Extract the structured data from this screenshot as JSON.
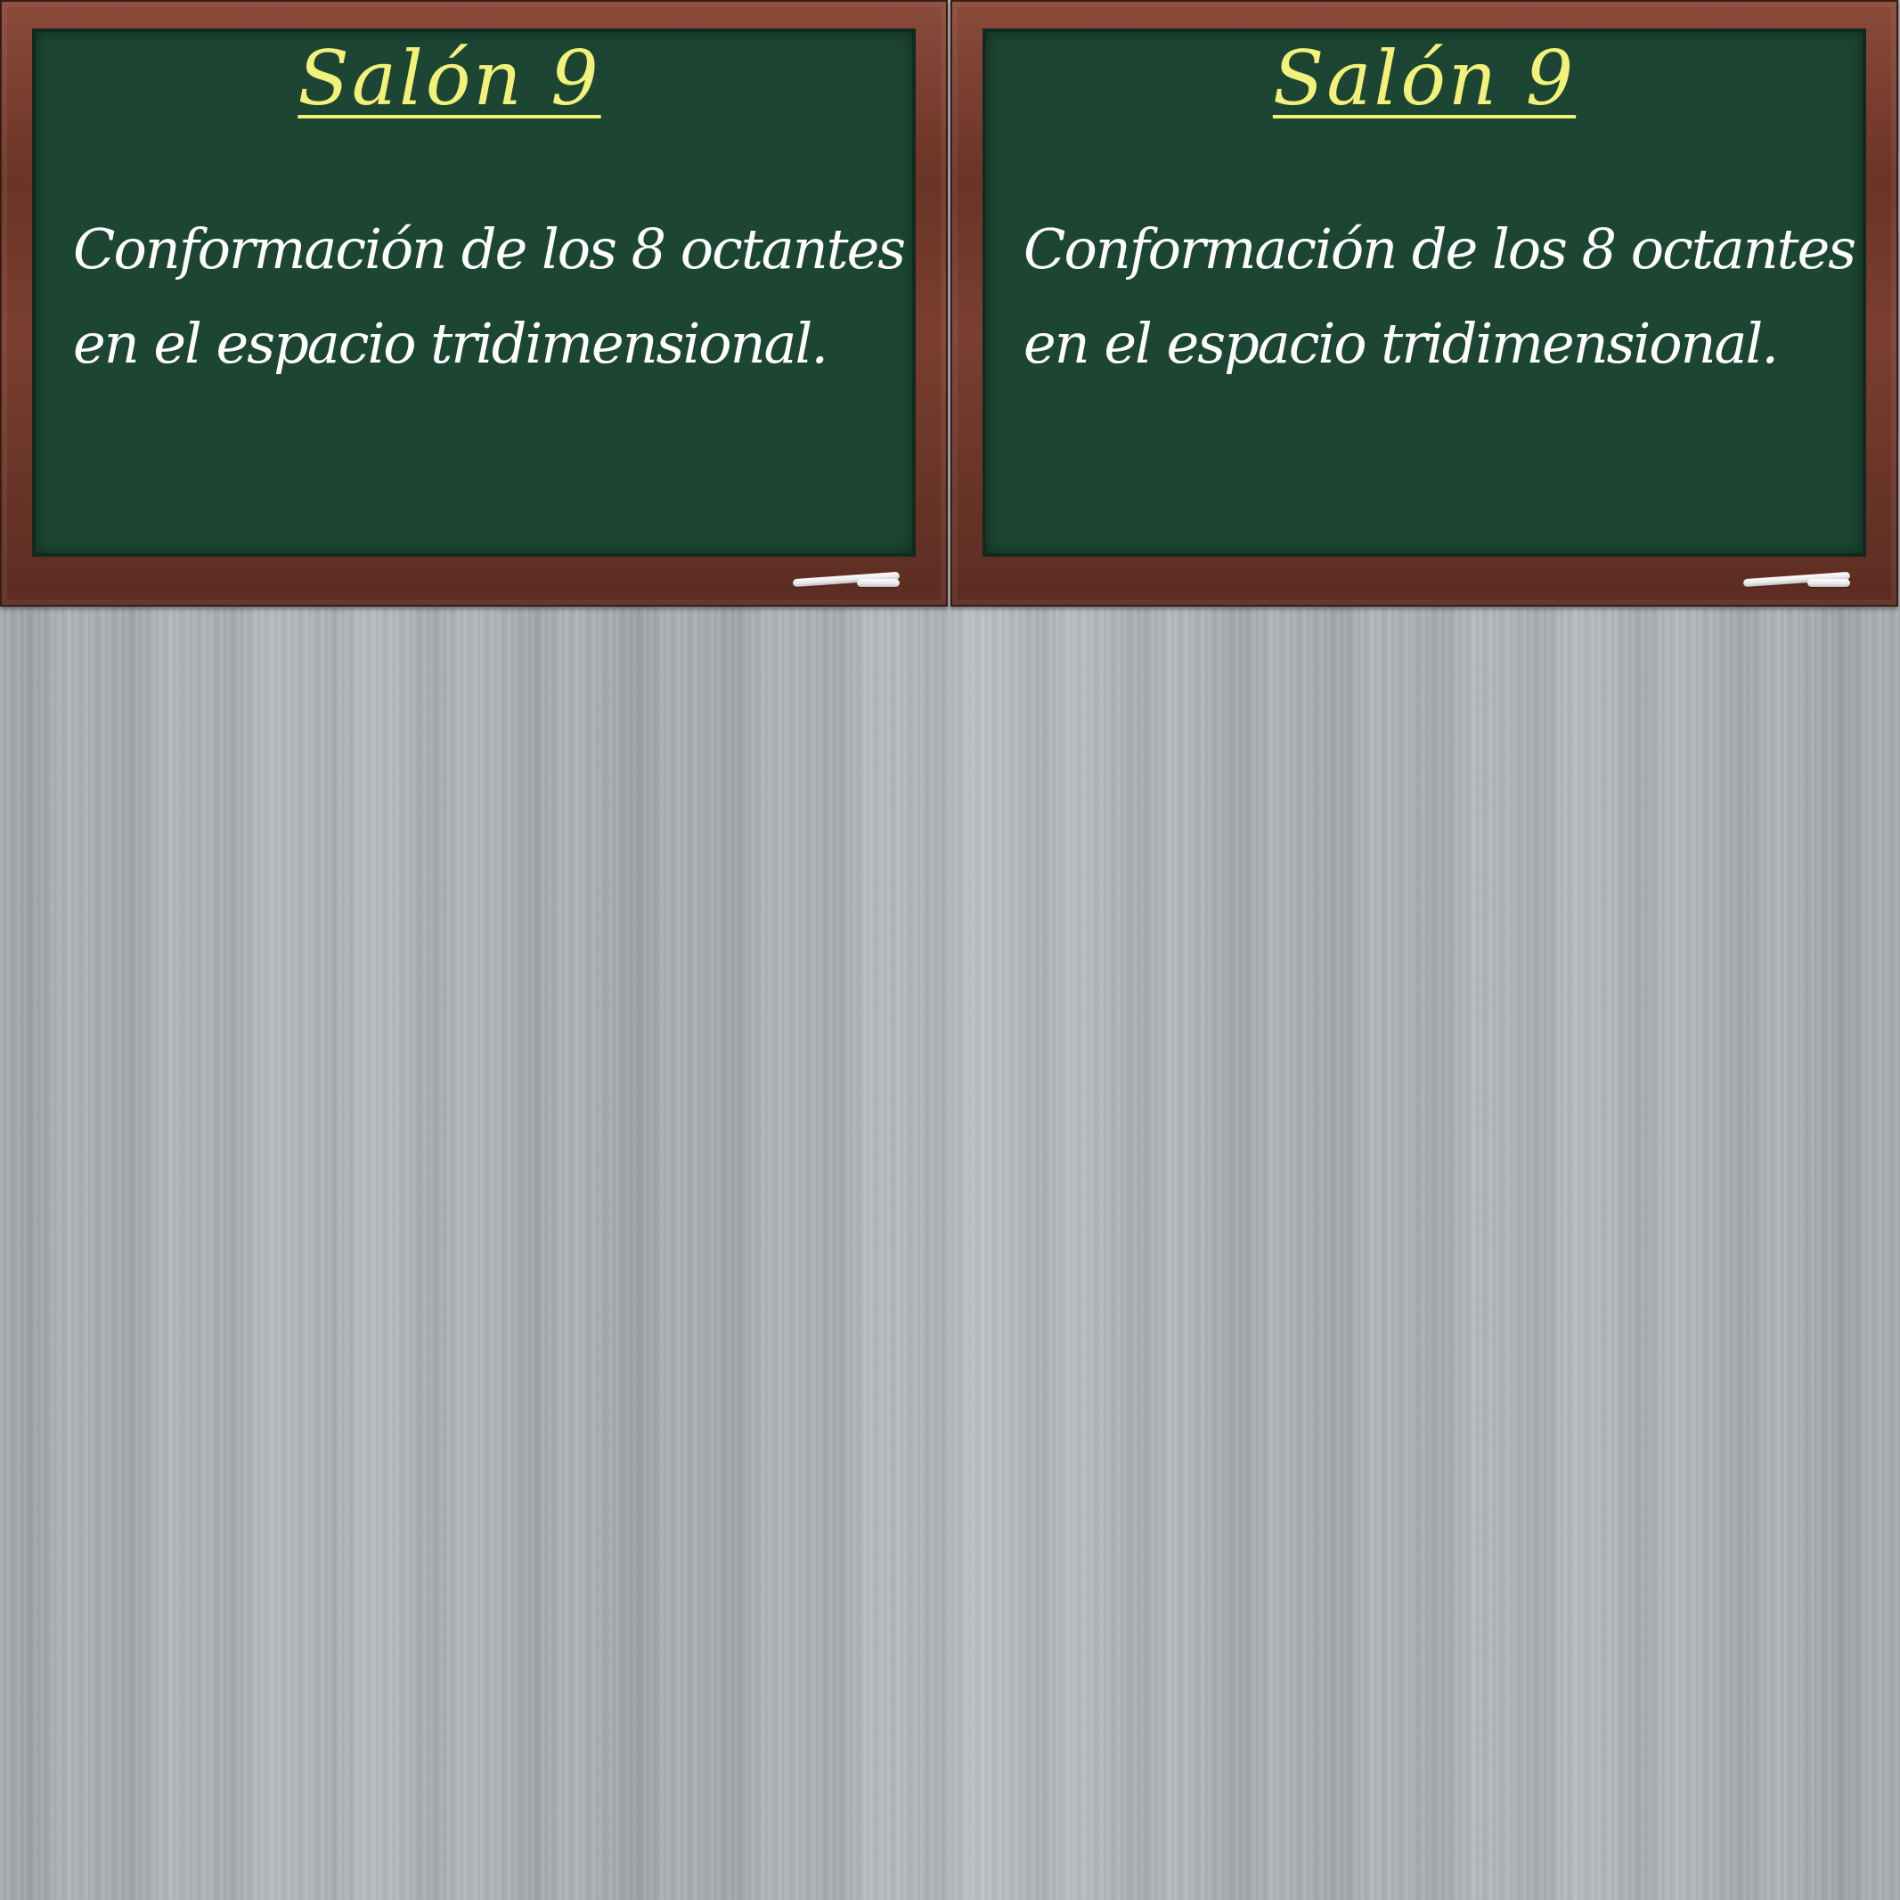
{
  "boards": [
    {
      "title": "Salón 9",
      "lines": [
        "Conformación de los 8 octantes",
        "en el espacio tridimensional."
      ]
    },
    {
      "title": "Salón 9",
      "lines": [
        "Conformación de los 8 octantes",
        "en el espacio tridimensional."
      ]
    }
  ],
  "colors": {
    "chalkboard": "#1c4633",
    "frame": "#6b3426",
    "title": "#f3f17a",
    "text": "#ffffff",
    "background": "#a9aeb2"
  }
}
